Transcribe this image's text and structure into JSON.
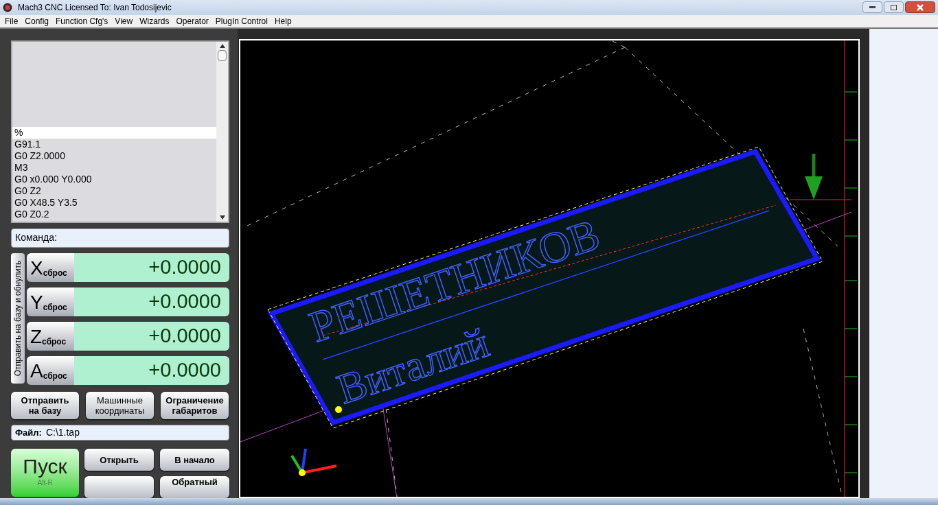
{
  "window": {
    "title": "Mach3 CNC  Licensed To: Ivan Todosijevic"
  },
  "menu": [
    "File",
    "Config",
    "Function Cfg's",
    "View",
    "Wizards",
    "Operator",
    "PlugIn Control",
    "Help"
  ],
  "gcode": [
    {
      "text": "%",
      "selected": true
    },
    {
      "text": "G91.1",
      "selected": false
    },
    {
      "text": "G0 Z2.0000",
      "selected": false
    },
    {
      "text": "M3",
      "selected": false
    },
    {
      "text": "G0 x0.000 Y0.000",
      "selected": false
    },
    {
      "text": "G0 Z2",
      "selected": false
    },
    {
      "text": "G0 X48.5 Y3.5",
      "selected": false
    },
    {
      "text": "G0 Z0.2",
      "selected": false
    }
  ],
  "command": {
    "label": "Команда:"
  },
  "ref_all_label": "Отправить на базу и обнулить",
  "axes": [
    {
      "letter": "X",
      "reset": "сброс",
      "value": "+0.0000"
    },
    {
      "letter": "Y",
      "reset": "сброс",
      "value": "+0.0000"
    },
    {
      "letter": "Z",
      "reset": "сброс",
      "value": "+0.0000"
    },
    {
      "letter": "A",
      "reset": "сброс",
      "value": "+0.0000"
    }
  ],
  "axis_buttons": [
    {
      "lines": [
        "Отправить",
        "на базу"
      ],
      "disabled": false
    },
    {
      "lines": [
        "Машинные",
        "координаты"
      ],
      "disabled": true
    },
    {
      "lines": [
        "Ограничение",
        "габаритов"
      ],
      "disabled": false
    }
  ],
  "file": {
    "label": "Файл:",
    "value": "C:\\1.tap"
  },
  "run_button": {
    "label": "Пуск",
    "hotkey": "Alt-R"
  },
  "program_buttons": [
    {
      "kind": "labeled",
      "label": "Открыть"
    },
    {
      "kind": "labeled",
      "label": "В начало"
    },
    {
      "kind": "blank"
    },
    {
      "kind": "labeled",
      "label": "Обратный"
    }
  ],
  "viewport": {
    "engraving": [
      "РЕШЕТНИКОВ",
      "Виталий"
    ]
  }
}
